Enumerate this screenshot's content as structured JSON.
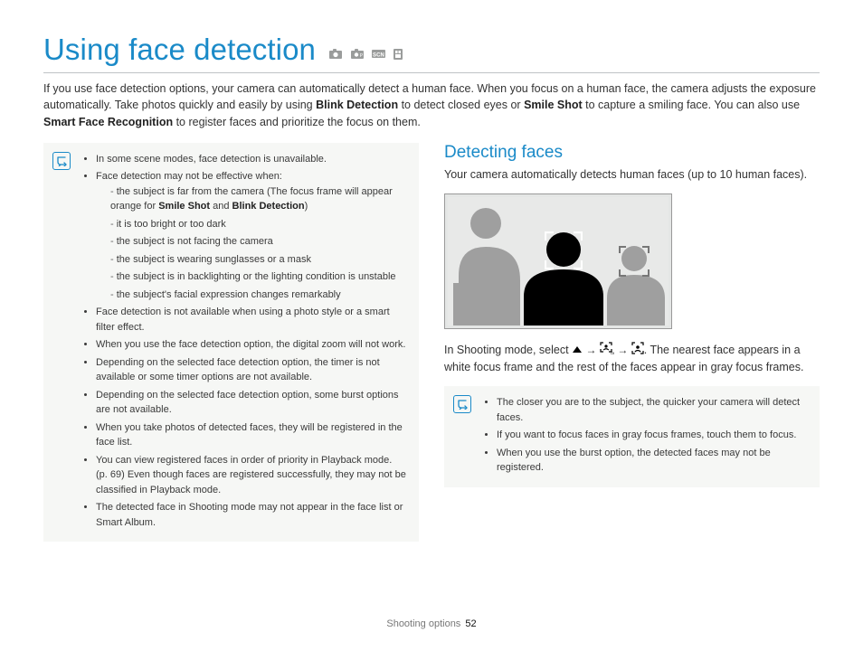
{
  "title": "Using face detection",
  "intro_parts": {
    "p1": "If you use face detection options, your camera can automatically detect a human face. When you focus on a human face, the camera adjusts the exposure automatically. Take photos quickly and easily by using ",
    "b1": "Blink Detection",
    "p2": " to detect closed eyes or ",
    "b2": "Smile Shot",
    "p3": " to capture a smiling face. You can also use ",
    "b3": "Smart Face Recognition",
    "p4": " to register faces and prioritize the focus on them."
  },
  "notes_left": {
    "items": [
      {
        "text": "In some scene modes, face detection is unavailable."
      },
      {
        "text": "Face detection may not be effective when:",
        "sub": [
          {
            "pre": "the subject is far from the camera (The focus frame will appear orange for ",
            "b1": "Smile Shot",
            "mid": " and ",
            "b2": "Blink Detection",
            "post": ")"
          },
          {
            "pre": "it is too bright or too dark"
          },
          {
            "pre": "the subject is not facing the camera"
          },
          {
            "pre": "the subject is wearing sunglasses or a mask"
          },
          {
            "pre": "the subject is in backlighting or the lighting condition is unstable"
          },
          {
            "pre": "the subject's facial expression changes remarkably"
          }
        ]
      },
      {
        "text": "Face detection is not available when using a photo style or a smart filter effect."
      },
      {
        "text": "When you use the face detection option, the digital zoom will not work."
      },
      {
        "text": "Depending on the selected face detection option, the timer is not available or some timer options are not available."
      },
      {
        "text": "Depending on the selected face detection option, some burst options are not available."
      },
      {
        "text": "When you take photos of detected faces, they will be registered in the face list."
      },
      {
        "text": "You can view registered faces in order of priority in Playback mode. (p. 69) Even though faces are registered successfully, they may not be classified in Playback mode."
      },
      {
        "text": "The detected face in Shooting mode may not appear in the face list or Smart Album."
      }
    ]
  },
  "right": {
    "heading": "Detecting faces",
    "sub_intro": "Your camera automatically detects human faces (up to 10 human faces).",
    "instruction_pre": "In Shooting mode, select ",
    "instruction_post": ". The nearest face appears in a white focus frame and the rest of the faces appear in gray focus frames.",
    "notes": [
      "The closer you are to the subject, the quicker your camera will detect faces.",
      "If you want to focus faces in gray focus frames, touch them to focus.",
      "When you use the burst option, the detected faces may not be registered."
    ]
  },
  "footer": {
    "section": "Shooting options",
    "page": "52"
  }
}
